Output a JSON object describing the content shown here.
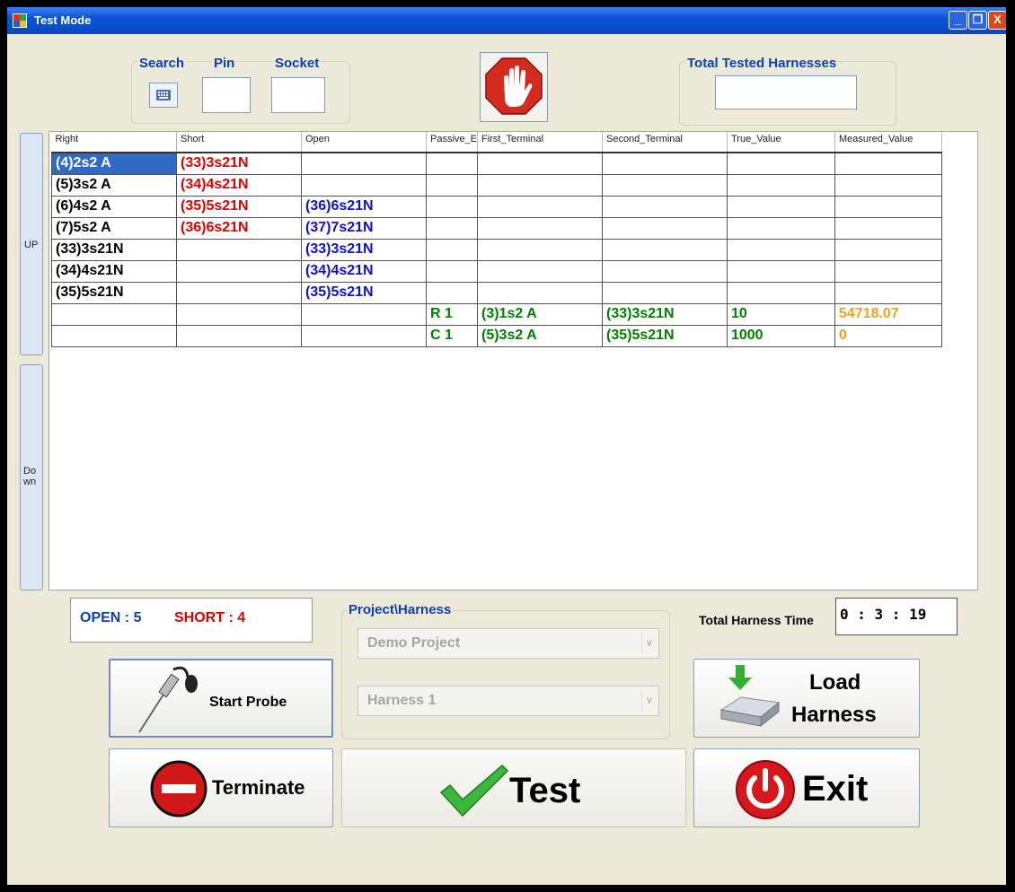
{
  "window": {
    "title": "Test Mode",
    "min_label": "_",
    "max_label": "❐",
    "close_label": "X"
  },
  "search_group": {
    "search_label": "Search",
    "pin_label": "Pin",
    "socket_label": "Socket",
    "pin_value": "",
    "socket_value": ""
  },
  "total_tested": {
    "label": "Total Tested Harnesses",
    "value": ""
  },
  "side": {
    "up_label": "UP",
    "down_label": "Do\nwn"
  },
  "grid": {
    "columns": [
      "Right",
      "Short",
      "Open",
      "Passive_E",
      "First_Terminal",
      "Second_Terminal",
      "True_Value",
      "Measured_Value"
    ],
    "rows": [
      [
        "(4)2s2 A",
        "(33)3s21N",
        "",
        "",
        "",
        "",
        "",
        ""
      ],
      [
        "(5)3s2 A",
        "(34)4s21N",
        "",
        "",
        "",
        "",
        "",
        ""
      ],
      [
        "(6)4s2 A",
        "(35)5s21N",
        "(36)6s21N",
        "",
        "",
        "",
        "",
        ""
      ],
      [
        "(7)5s2 A",
        "(36)6s21N",
        "(37)7s21N",
        "",
        "",
        "",
        "",
        ""
      ],
      [
        "(33)3s21N",
        "",
        "(33)3s21N",
        "",
        "",
        "",
        "",
        ""
      ],
      [
        "(34)4s21N",
        "",
        "(34)4s21N",
        "",
        "",
        "",
        "",
        ""
      ],
      [
        "(35)5s21N",
        "",
        "(35)5s21N",
        "",
        "",
        "",
        "",
        ""
      ],
      [
        "",
        "",
        "",
        "R 1",
        "(3)1s2 A",
        "(33)3s21N",
        "10",
        "54718.07"
      ],
      [
        "",
        "",
        "",
        "C 1",
        "(5)3s2 A",
        "(35)5s21N",
        "1000",
        "0"
      ]
    ]
  },
  "counts": {
    "open_label": "OPEN : 5",
    "short_label": "SHORT : 4"
  },
  "project": {
    "group_label": "Project\\Harness",
    "project_value": "Demo Project",
    "harness_value": "Harness 1"
  },
  "time": {
    "label": "Total Harness Time",
    "value": "0 : 3 : 19"
  },
  "buttons": {
    "start_probe": "Start Probe",
    "load": "Load",
    "harness": "Harness",
    "terminate": "Terminate",
    "test": "Test",
    "exit": "Exit"
  },
  "colors": {
    "title_blue": "#0a53d9",
    "group_label": "#0d3fb4",
    "short_red": "#e00000",
    "open_blue": "#1010d0",
    "pass_green": "#008000",
    "measured_orange": "#f0a020",
    "selection": "#316ac5"
  }
}
